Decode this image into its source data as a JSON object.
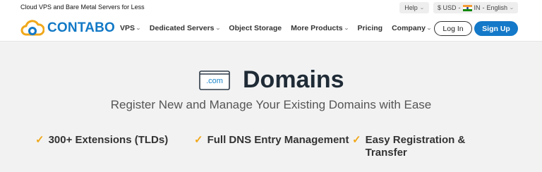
{
  "topbar": {
    "tagline": "Cloud VPS and Bare Metal Servers for Less",
    "help_label": "Help",
    "currency": "$ USD",
    "region": "IN",
    "language": "English"
  },
  "nav": {
    "logo_text": "CONTABO",
    "links": [
      {
        "label": "VPS",
        "dropdown": true
      },
      {
        "label": "Dedicated Servers",
        "dropdown": true
      },
      {
        "label": "Object Storage",
        "dropdown": false
      },
      {
        "label": "More Products",
        "dropdown": true
      },
      {
        "label": "Pricing",
        "dropdown": false
      },
      {
        "label": "Company",
        "dropdown": true
      }
    ],
    "login_label": "Log In",
    "signup_label": "Sign Up"
  },
  "hero": {
    "icon_label": ".com",
    "title": "Domains",
    "subtitle": "Register New and Manage Your Existing Domains with Ease",
    "features": [
      {
        "line1": "300+ Extensions (TLDs)",
        "line2": ""
      },
      {
        "line1": "Full DNS Entry Management",
        "line2": ""
      },
      {
        "line1": "Easy Registration &",
        "line2": "Transfer"
      }
    ]
  },
  "colors": {
    "brand_blue": "#1479c8",
    "check_orange": "#f0a81a",
    "background": "#f2f2f2"
  }
}
